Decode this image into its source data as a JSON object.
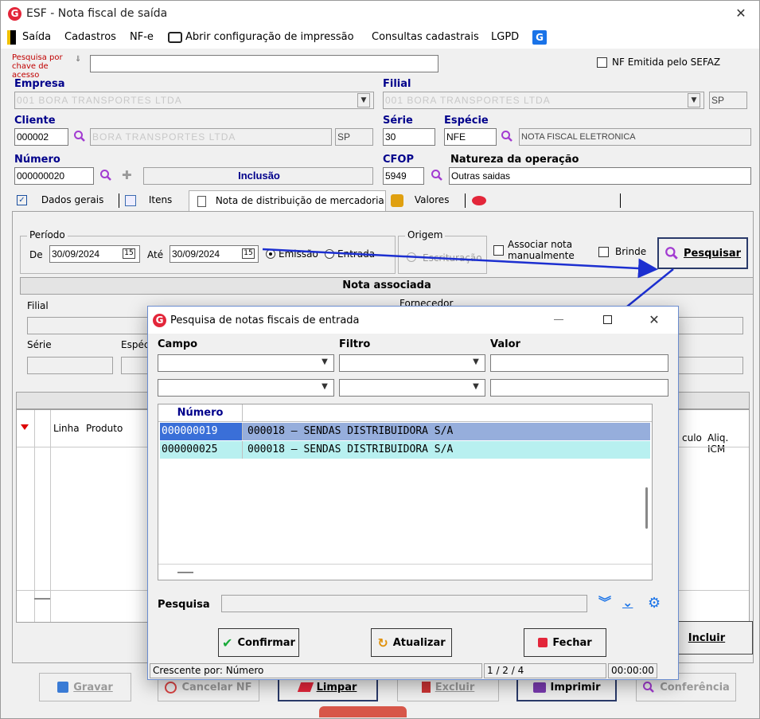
{
  "window": {
    "title": "ESF - Nota fiscal de saída"
  },
  "menu": {
    "saida": "Saída",
    "cadastros": "Cadastros",
    "nfe": "NF-e",
    "abrir_config": "Abrir configuração de impressão",
    "consultas": "Consultas cadastrais",
    "lgpd": "LGPD"
  },
  "search_key": {
    "label": "Pesquisa por chave de acesso",
    "value": ""
  },
  "nf_sefaz": {
    "label": "NF Emitida pelo SEFAZ",
    "checked": false
  },
  "empresa": {
    "label": "Empresa",
    "value": "001 BORA TRANSPORTES LTDA"
  },
  "filial": {
    "label": "Filial",
    "value": "001 BORA TRANSPORTES LTDA",
    "uf": "SP"
  },
  "cliente": {
    "label": "Cliente",
    "code": "000002",
    "name": "BORA TRANSPORTES LTDA",
    "uf": "SP"
  },
  "serie": {
    "label": "Série",
    "value": "30"
  },
  "especie": {
    "label": "Espécie",
    "code": "NFE",
    "desc": "NOTA FISCAL ELETRONICA"
  },
  "numero": {
    "label": "Número",
    "value": "000000020",
    "mode": "Inclusão"
  },
  "cfop": {
    "label": "CFOP",
    "value": "5949"
  },
  "natureza": {
    "label": "Natureza da operação",
    "value": "Outras saidas"
  },
  "tabs": [
    {
      "label": "Dados gerais"
    },
    {
      "label": "Itens"
    },
    {
      "label": "Nota de distribuição de mercadoria"
    },
    {
      "label": "Valores"
    }
  ],
  "periodo": {
    "title": "Período",
    "de_label": "De",
    "de_value": "30/09/2024",
    "ate_label": "Até",
    "ate_value": "30/09/2024",
    "calendar": "15",
    "emissao": "Emissão",
    "entrada": "Entrada"
  },
  "origem": {
    "title": "Origem",
    "escrituracao": "Escrituração"
  },
  "associar": {
    "label": "Associar nota manualmente"
  },
  "brinde": {
    "label": "Brinde"
  },
  "pesquisar_btn": "Pesquisar",
  "nota_associada": {
    "title": "Nota associada",
    "filial": "Filial",
    "fornecedor": "Fornecedor",
    "serie": "Série",
    "especie": "Espéc"
  },
  "items_grid": {
    "headers": [
      "Linha",
      "Produto",
      "culo",
      "Aliq. ICM"
    ]
  },
  "incluir_btn": "Incluir",
  "bottom_buttons": {
    "gravar": "Gravar",
    "cancelar": "Cancelar NF",
    "limpar": "Limpar",
    "excluir": "Excluir",
    "imprimir": "Imprimir",
    "conferencia": "Conferência"
  },
  "dialog": {
    "title": "Pesquisa de notas fiscais de entrada",
    "campo": "Campo",
    "filtro": "Filtro",
    "valor": "Valor",
    "list_header": "Número",
    "rows": [
      {
        "numero": "000000019",
        "desc": "000018 – SENDAS DISTRIBUIDORA S/A"
      },
      {
        "numero": "000000025",
        "desc": "000018 – SENDAS DISTRIBUIDORA S/A"
      }
    ],
    "pesquisa_label": "Pesquisa",
    "pesquisa_value": "",
    "confirmar": "Confirmar",
    "atualizar": "Atualizar",
    "fechar": "Fechar",
    "status": {
      "ordem": "Crescente por: Número",
      "pos": "1 / 2 / 4",
      "tempo": "00:00:00"
    }
  },
  "colors": {
    "accent_blue": "#00008b",
    "selected_row": "#96aedc",
    "alt_row": "#b8f0f0",
    "arrow": "#1c2fd0",
    "brand_red": "#e3263a"
  }
}
